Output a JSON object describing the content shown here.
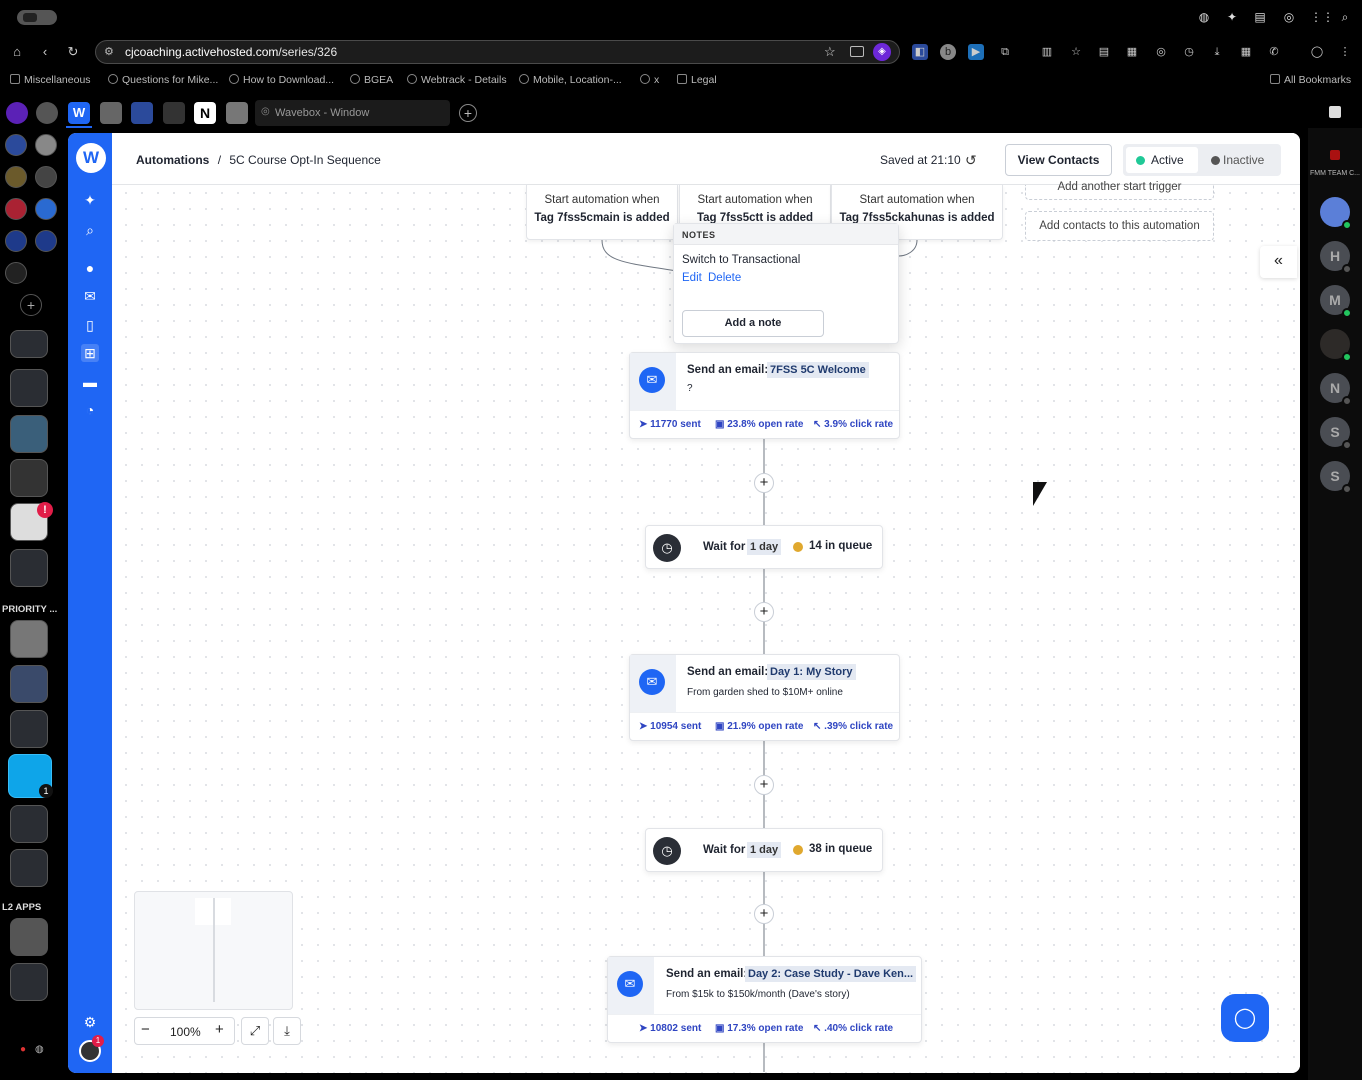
{
  "browser": {
    "url": "cjcoaching.activehosted.com/series/326",
    "url_host": "cjcoaching.activehosted.com",
    "url_path": "/series/326",
    "bookmarks": [
      "Miscellaneous",
      "Questions for Mike...",
      "How to Download...",
      "BGEA",
      "Webtrack - Details",
      "Mobile, Location-...",
      "x",
      "Legal"
    ],
    "all_bookmarks": "All Bookmarks",
    "tab_title": "Wavebox - Window"
  },
  "app_rail": {
    "priority_label": "PRIORITY ...",
    "l2_label": "L2 APPS",
    "badge_count": "1",
    "alert_badge": "!"
  },
  "header": {
    "breadcrumb_root": "Automations",
    "breadcrumb_sep": "/",
    "breadcrumb_current": "5C Course Opt-In Sequence",
    "saved_text": "Saved at 21:10",
    "view_contacts": "View Contacts",
    "active_label": "Active",
    "inactive_label": "Inactive"
  },
  "triggers": [
    {
      "line1": "Start automation when",
      "line2": "Tag 7fss5cmain is added"
    },
    {
      "line1": "Start automation when",
      "line2": "Tag 7fss5ctt is added"
    },
    {
      "line1": "Start automation when",
      "line2": "Tag 7fss5ckahunas is added"
    }
  ],
  "add_start_trigger": "Add another start trigger",
  "add_contacts": "Add contacts to this automation",
  "notes": {
    "title": "NOTES",
    "text": "Switch to Transactional",
    "edit": "Edit",
    "delete": "Delete",
    "add_note": "Add a note"
  },
  "steps": {
    "email1": {
      "label": "Send an email:",
      "name": "7FSS 5C Welcome",
      "subtitle": "?",
      "sent": "11770 sent",
      "open": "23.8% open rate",
      "click": "3.9% click rate"
    },
    "wait1": {
      "label": "Wait for",
      "duration": "1 day",
      "queue": "14 in queue"
    },
    "email2": {
      "label": "Send an email:",
      "name": "Day 1: My Story",
      "subtitle": "From garden shed to $10M+ online",
      "sent": "10954 sent",
      "open": "21.9% open rate",
      "click": ".39% click rate"
    },
    "wait2": {
      "label": "Wait for",
      "duration": "1 day",
      "queue": "38 in queue"
    },
    "email3": {
      "label": "Send an email:",
      "name": "Day 2: Case Study - Dave Ken...",
      "subtitle": "From $15k to $150k/month (Dave's story)",
      "sent": "10802 sent",
      "open": "17.3% open rate",
      "click": ".40% click rate"
    }
  },
  "zoom": {
    "level": "100%",
    "minus": "−",
    "plus": "+"
  },
  "right_rail": {
    "team_label": "FMM TEAM C...",
    "avatars": [
      "H",
      "M",
      "N",
      "S",
      "S"
    ]
  },
  "colors": {
    "brand": "#1f66f4",
    "active": "#20c997",
    "queue": "#e0a82e",
    "stat": "#2f45c2"
  }
}
